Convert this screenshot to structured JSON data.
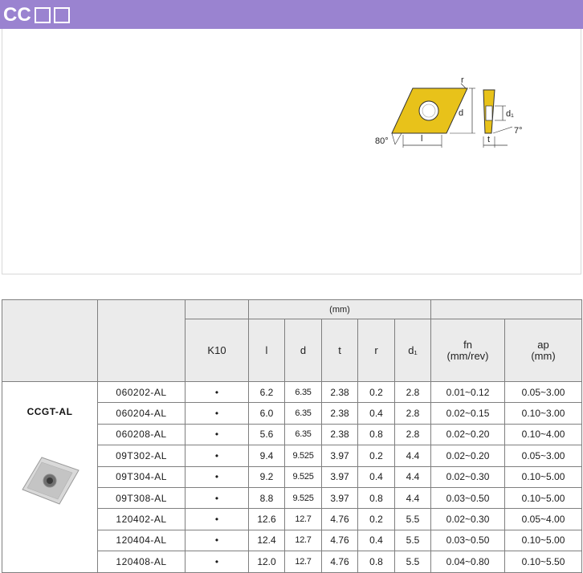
{
  "header": {
    "title": "CC",
    "title_suffix_glyphs": [
      "□",
      "□"
    ],
    "bar_color": "#9a83d0"
  },
  "diagram": {
    "labels": {
      "r": "r",
      "d": "d",
      "l": "l",
      "angle": "80°",
      "d1": "d₁",
      "t": "t",
      "clearance": "7°"
    },
    "insert_color": "#e8c21a"
  },
  "table": {
    "unit_label": "(mm)",
    "headers": {
      "grade": "K10",
      "l": "l",
      "d": "d",
      "t": "t",
      "r": "r",
      "d1": "d₁",
      "fn_line1": "fn",
      "fn_line2": "(mm/rev)",
      "ap_line1": "ap",
      "ap_line2": "(mm)"
    },
    "model": "CCGT-AL",
    "rows": [
      {
        "code": "060202-AL",
        "k10": "•",
        "l": "6.2",
        "d": "6.35",
        "t": "2.38",
        "r": "0.2",
        "d1": "2.8",
        "fn": "0.01~0.12",
        "ap": "0.05~3.00"
      },
      {
        "code": "060204-AL",
        "k10": "•",
        "l": "6.0",
        "d": "6.35",
        "t": "2.38",
        "r": "0.4",
        "d1": "2.8",
        "fn": "0.02~0.15",
        "ap": "0.10~3.00"
      },
      {
        "code": "060208-AL",
        "k10": "•",
        "l": "5.6",
        "d": "6.35",
        "t": "2.38",
        "r": "0.8",
        "d1": "2.8",
        "fn": "0.02~0.20",
        "ap": "0.10~4.00"
      },
      {
        "code": "09T302-AL",
        "k10": "•",
        "l": "9.4",
        "d": "9.525",
        "t": "3.97",
        "r": "0.2",
        "d1": "4.4",
        "fn": "0.02~0.20",
        "ap": "0.05~3.00"
      },
      {
        "code": "09T304-AL",
        "k10": "•",
        "l": "9.2",
        "d": "9.525",
        "t": "3.97",
        "r": "0.4",
        "d1": "4.4",
        "fn": "0.02~0.30",
        "ap": "0.10~5.00"
      },
      {
        "code": "09T308-AL",
        "k10": "•",
        "l": "8.8",
        "d": "9.525",
        "t": "3.97",
        "r": "0.8",
        "d1": "4.4",
        "fn": "0.03~0.50",
        "ap": "0.10~5.00"
      },
      {
        "code": "120402-AL",
        "k10": "•",
        "l": "12.6",
        "d": "12.7",
        "t": "4.76",
        "r": "0.2",
        "d1": "5.5",
        "fn": "0.02~0.30",
        "ap": "0.05~4.00"
      },
      {
        "code": "120404-AL",
        "k10": "•",
        "l": "12.4",
        "d": "12.7",
        "t": "4.76",
        "r": "0.4",
        "d1": "5.5",
        "fn": "0.03~0.50",
        "ap": "0.10~5.00"
      },
      {
        "code": "120408-AL",
        "k10": "•",
        "l": "12.0",
        "d": "12.7",
        "t": "4.76",
        "r": "0.8",
        "d1": "5.5",
        "fn": "0.04~0.80",
        "ap": "0.10~5.50"
      }
    ]
  }
}
